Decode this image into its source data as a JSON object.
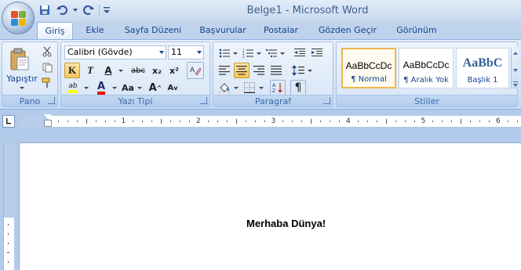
{
  "window": {
    "title": "Belge1 - Microsoft Word"
  },
  "quick_access": {
    "icons": [
      "save-icon",
      "undo-icon",
      "redo-icon",
      "customize-icon"
    ]
  },
  "tabs": [
    {
      "label": "Giriş",
      "active": true
    },
    {
      "label": "Ekle"
    },
    {
      "label": "Sayfa Düzeni"
    },
    {
      "label": "Başvurular"
    },
    {
      "label": "Postalar"
    },
    {
      "label": "Gözden Geçir"
    },
    {
      "label": "Görünüm"
    }
  ],
  "ribbon": {
    "clipboard": {
      "paste_label": "Yapıştır",
      "group_label": "Pano"
    },
    "font": {
      "font_name": "Calibri (Gövde)",
      "font_size": "11",
      "bold": "K",
      "italic": "T",
      "underline": "A",
      "strike": "abc",
      "subscript": "x₂",
      "superscript": "x²",
      "highlight": "ab",
      "font_color": "A",
      "change_case": "Aa",
      "grow": "A",
      "shrink": "A",
      "group_label": "Yazı Tipi"
    },
    "paragraph": {
      "pilcrow": "¶",
      "group_label": "Paragraf"
    },
    "styles": {
      "items": [
        {
          "sample": "AaBbCcDc",
          "name": "¶ Normal",
          "active": true
        },
        {
          "sample": "AaBbCcDc",
          "name": "¶ Aralık Yok"
        },
        {
          "sample": "AaBbC",
          "name": "Başlık 1"
        }
      ],
      "group_label": "Stiller"
    }
  },
  "ruler": {
    "numbers": [
      "1",
      "2",
      "3",
      "4",
      "5",
      "6"
    ]
  },
  "document": {
    "text": "Merhaba Dünya!"
  },
  "colors": {
    "accent": "#15428b",
    "highlight": "#ffff00",
    "font_color": "#ff0000",
    "active_style": "#f1b64b"
  }
}
